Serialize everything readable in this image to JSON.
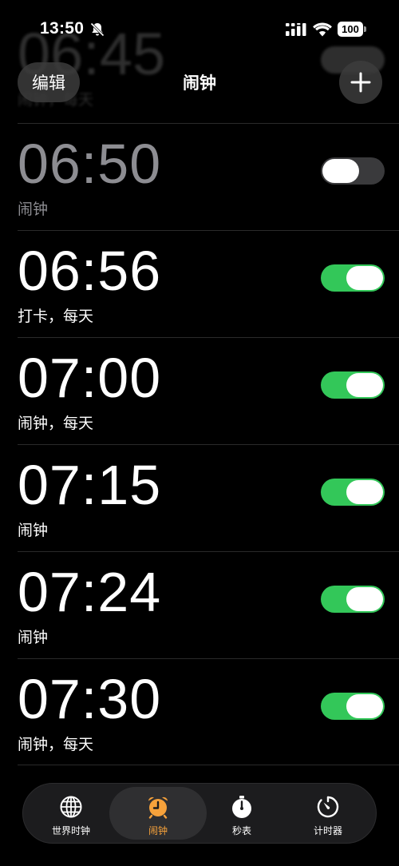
{
  "status_bar": {
    "time": "13:50",
    "battery": "100"
  },
  "ghost_alarm": {
    "time": "06:45",
    "label": "闹钟，每天"
  },
  "nav": {
    "edit_label": "编辑",
    "title": "闹钟"
  },
  "alarms": [
    {
      "time": "06:50",
      "label": "闹钟",
      "enabled": false
    },
    {
      "time": "06:56",
      "label": "打卡，每天",
      "enabled": true
    },
    {
      "time": "07:00",
      "label": "闹钟，每天",
      "enabled": true
    },
    {
      "time": "07:15",
      "label": "闹钟",
      "enabled": true
    },
    {
      "time": "07:24",
      "label": "闹钟",
      "enabled": true
    },
    {
      "time": "07:30",
      "label": "闹钟，每天",
      "enabled": true
    }
  ],
  "tabs": [
    {
      "label": "世界时钟",
      "icon": "globe-icon",
      "active": false
    },
    {
      "label": "闹钟",
      "icon": "alarm-clock-icon",
      "active": true
    },
    {
      "label": "秒表",
      "icon": "stopwatch-icon",
      "active": false
    },
    {
      "label": "计时器",
      "icon": "timer-icon",
      "active": false
    }
  ],
  "colors": {
    "toggle_on": "#33c759",
    "toggle_off": "#3a3a3c",
    "accent": "#f7a23b",
    "background": "#000000"
  }
}
